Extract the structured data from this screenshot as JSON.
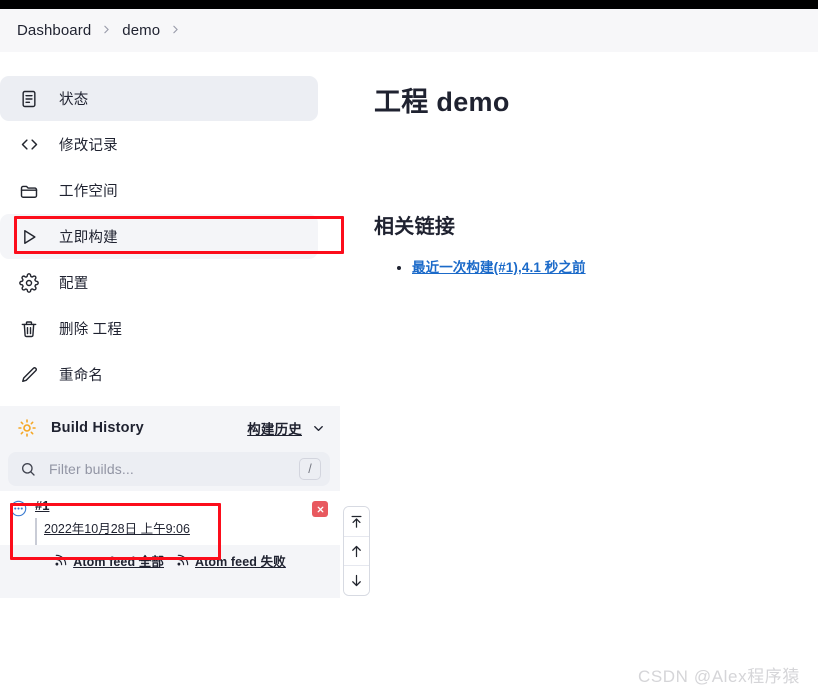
{
  "breadcrumb": {
    "items": [
      {
        "label": "Dashboard"
      },
      {
        "label": "demo"
      }
    ],
    "separator_icon": "chevron-right-icon"
  },
  "sidebar": {
    "items": [
      {
        "label": "状态",
        "icon": "document-icon",
        "state": "active"
      },
      {
        "label": "修改记录",
        "icon": "code-icon",
        "state": "normal"
      },
      {
        "label": "工作空间",
        "icon": "folder-icon",
        "state": "normal"
      },
      {
        "label": "立即构建",
        "icon": "play-icon",
        "state": "hovered"
      },
      {
        "label": "配置",
        "icon": "gear-icon",
        "state": "normal"
      },
      {
        "label": "删除 工程",
        "icon": "trash-icon",
        "state": "normal"
      },
      {
        "label": "重命名",
        "icon": "pencil-icon",
        "state": "normal"
      }
    ]
  },
  "build_history": {
    "icon": "sun-icon",
    "title": "Build History",
    "dropdown_label": "构建历史",
    "dropdown_icon": "chevron-down-icon",
    "search": {
      "icon": "search-icon",
      "placeholder": "Filter builds...",
      "value": "",
      "shortcut": "/"
    },
    "builds": [
      {
        "status_icon": "in-progress-icon",
        "number": "#1",
        "timestamp": "2022年10月28日 上午9:06",
        "progress_visible": true,
        "stop_icon": "stop-build-icon"
      }
    ],
    "feeds": [
      {
        "icon": "rss-icon",
        "label": "Atom feed 全部"
      },
      {
        "icon": "rss-icon",
        "label": "Atom feed 失败"
      }
    ]
  },
  "scroll_controls": {
    "buttons": [
      {
        "icon": "jump-to-top-icon",
        "name": "scroll-to-top"
      },
      {
        "icon": "arrow-up-icon",
        "name": "scroll-up"
      },
      {
        "icon": "arrow-down-icon",
        "name": "scroll-down"
      }
    ]
  },
  "main": {
    "page_title": "工程 demo",
    "section_title": "相关链接",
    "links": [
      {
        "label": "最近一次构建(#1),4.1 秒之前"
      }
    ]
  },
  "annotations": {
    "highlight_color": "#fc0d1b",
    "boxes": [
      {
        "target": "sidebar-item-build-now"
      },
      {
        "target": "build-history-row"
      }
    ]
  },
  "watermark": {
    "text": "CSDN @Alex程序猿"
  },
  "colors": {
    "topbar": "#000000",
    "breadcrumb_bg": "#f7f7f9",
    "sidebar_active_bg": "#eceef3",
    "panel_bg": "#f4f5f8",
    "link_blue": "#1b6ac9",
    "progress_blue": "#2a5ba6",
    "stop_red": "#e8595f",
    "sun_yellow": "#f5a623",
    "annotation_red": "#fc0d1b"
  }
}
